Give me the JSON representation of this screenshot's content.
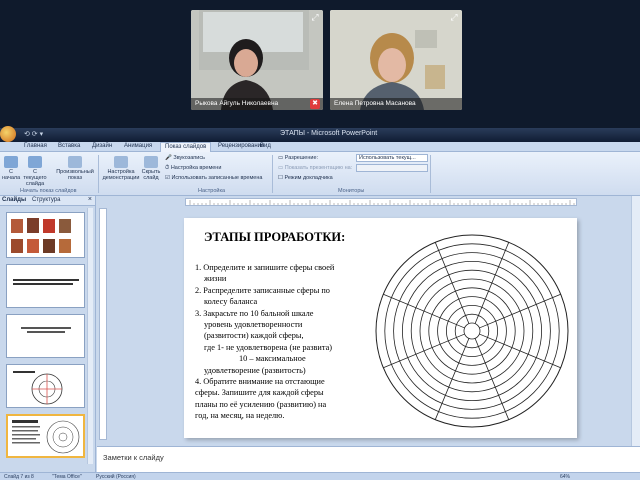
{
  "video_call": {
    "participants": [
      {
        "name": "Рыкова Айгуль Николаевна"
      },
      {
        "name": "Елена Петровна Масанова"
      }
    ]
  },
  "app": {
    "title": "ЭТАПЫ - Microsoft PowerPoint",
    "qat": "⟲ ⟳ ▾",
    "tabs": [
      "Главная",
      "Вставка",
      "Дизайн",
      "Анимация",
      "Показ слайдов",
      "Рецензирование",
      "Вид"
    ],
    "active_tab": "Показ слайдов"
  },
  "ribbon": {
    "buttons": [
      {
        "label": "С начала"
      },
      {
        "label": "С текущего слайда"
      },
      {
        "label": "Произвольный показ"
      },
      {
        "label": "Настройка демонстрации"
      },
      {
        "label": "Скрыть слайд"
      }
    ],
    "small_items": [
      "Звукозапись",
      "Настройка времени",
      "Использовать записанные времена",
      "Разрешение:",
      "Показать презентацию на:",
      "Режим докладчика"
    ],
    "dropdowns": {
      "resolution_value": "Использовать текущ...",
      "show_on_value": ""
    },
    "groups": [
      "Начать показ слайдов",
      "Настройка",
      "Мониторы"
    ]
  },
  "panel": {
    "tabs": [
      "Слайды",
      "Структура"
    ],
    "close_glyph": "×"
  },
  "slide": {
    "title": "ЭТАПЫ ПРОРАБОТКИ:",
    "lines": [
      {
        "text": "1. Определите и запишите сферы своей",
        "cls": "li"
      },
      {
        "text": "жизни",
        "cls": "ind"
      },
      {
        "text": "2. Распределите записанные сферы по",
        "cls": "li"
      },
      {
        "text": "колесу баланса",
        "cls": "ind"
      },
      {
        "text": "3. Закрасьте по 10 бальной шкале",
        "cls": "li"
      },
      {
        "text": "уровень удовлетворенности",
        "cls": "ind"
      },
      {
        "text": "(развитости) каждой сферы,",
        "cls": "ind"
      },
      {
        "text": "где 1- не удовлетворена (не развита)",
        "cls": "ind"
      },
      {
        "text": "10 – максимальное",
        "cls": "ind2"
      },
      {
        "text": "удовлетворение (развитость)",
        "cls": "ind"
      },
      {
        "text": "4. Обратите внимание на отстающие",
        "cls": "li"
      },
      {
        "text": "сферы. Запишите для каждой сферы",
        "cls": "li"
      },
      {
        "text": "планы по её усилению (развитию) на",
        "cls": "li"
      },
      {
        "text": "год, на месяц, на неделю.",
        "cls": "li"
      }
    ]
  },
  "notes": {
    "placeholder": "Заметки к слайду"
  },
  "status": {
    "slide": "Слайд 7 из 8",
    "theme": "\"Тема Office\"",
    "language": "Русский (Россия)",
    "zoom": "64%"
  },
  "colors": {
    "title_bar": "#0f1c33",
    "ribbon": "#dfe9f7",
    "workspace": "#c9d8ec",
    "selection": "#f0b640",
    "wheel_accent": "#d9534f"
  }
}
